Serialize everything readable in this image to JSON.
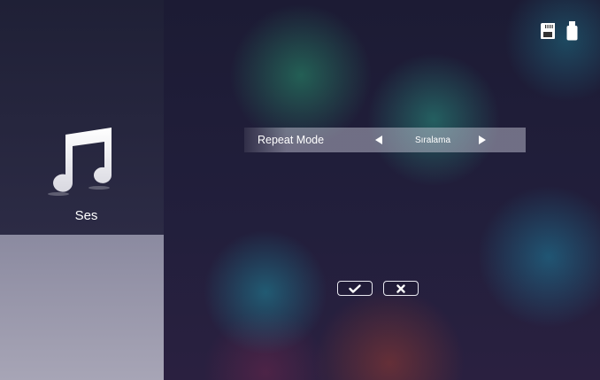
{
  "sidebar": {
    "section_label": "Ses",
    "section_icon": "music-note-icon"
  },
  "status_icons": [
    "sd-card-icon",
    "usb-drive-icon"
  ],
  "settings": {
    "repeat_mode": {
      "label": "Repeat Mode",
      "value": "Sıralama"
    }
  },
  "buttons": {
    "confirm_icon": "checkmark-icon",
    "cancel_icon": "x-icon"
  }
}
